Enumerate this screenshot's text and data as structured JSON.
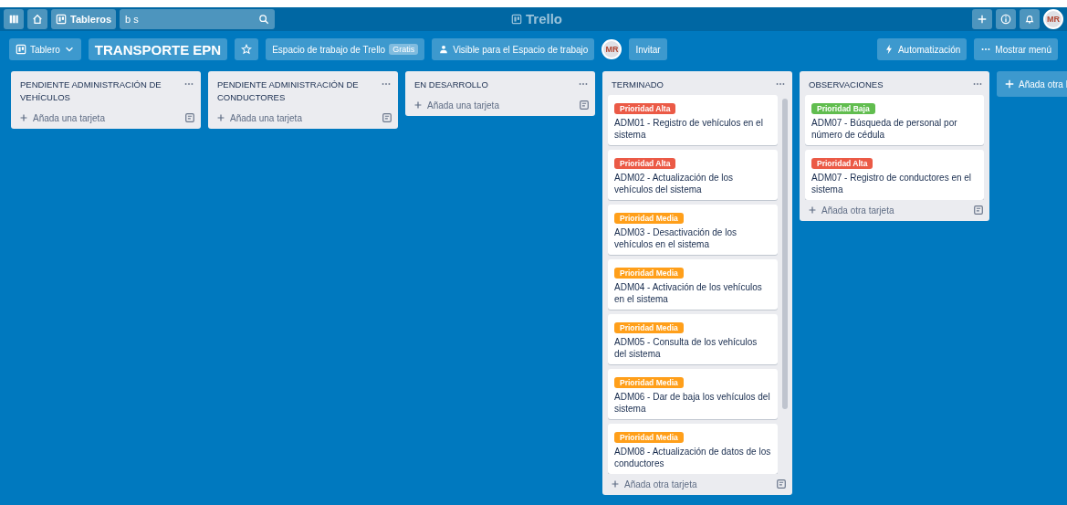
{
  "header": {
    "boards_button": "Tableros",
    "search": {
      "value": "b s"
    },
    "logo": "Trello",
    "avatar": "MR"
  },
  "board_bar": {
    "view_button": "Tablero",
    "board_title": "TRANSPORTE EPN",
    "starred": false,
    "workspace_button": "Espacio de trabajo de Trello",
    "workspace_badge": "Gratis",
    "visibility_button": "Visible para el Espacio de trabajo",
    "member_avatar": "MR",
    "invite_button": "Invitar",
    "automation_button": "Automatización",
    "menu_button": "Mostrar menú"
  },
  "lists": [
    {
      "title": "PENDIENTE ADMINISTRACIÓN DE VEHÍCULOS",
      "add_card": "Añada una tarjeta"
    },
    {
      "title": "PENDIENTE ADMINISTRACIÓN DE CONDUCTORES",
      "add_card": "Añada una tarjeta"
    },
    {
      "title": "EN DESARROLLO",
      "add_card": "Añada una tarjeta"
    },
    {
      "title": "TERMINADO",
      "cards": [
        {
          "label": "Prioridad Alta",
          "color": "#eb5a46",
          "text": "ADM01 - Registro de vehículos en el sistema"
        },
        {
          "label": "Prioridad Alta",
          "color": "#eb5a46",
          "text": "ADM02 - Actualización de los vehículos del sistema"
        },
        {
          "label": "Prioridad Media",
          "color": "#ff9f1a",
          "text": "ADM03 - Desactivación de los vehículos en el sistema"
        },
        {
          "label": "Prioridad Media",
          "color": "#ff9f1a",
          "text": "ADM04 - Activación de los vehículos en el sistema"
        },
        {
          "label": "Prioridad Media",
          "color": "#ff9f1a",
          "text": "ADM05 - Consulta de los vehículos del sistema"
        },
        {
          "label": "Prioridad Media",
          "color": "#ff9f1a",
          "text": "ADM06 - Dar de baja los vehículos del sistema"
        },
        {
          "label": "Prioridad Media",
          "color": "#ff9f1a",
          "text": "ADM08 - Actualización de datos de los conductores"
        }
      ],
      "add_card": "Añada otra tarjeta"
    },
    {
      "title": "OBSERVACIONES",
      "cards": [
        {
          "label": "Prioridad Baja",
          "color": "#61bd4f",
          "text": "ADM07 - Búsqueda de personal por número de cédula"
        },
        {
          "label": "Prioridad Alta",
          "color": "#eb5a46",
          "text": "ADM07 - Registro de conductores en el sistema"
        }
      ],
      "add_card": "Añada otra tarjeta"
    }
  ],
  "add_list": "Añada otra l"
}
